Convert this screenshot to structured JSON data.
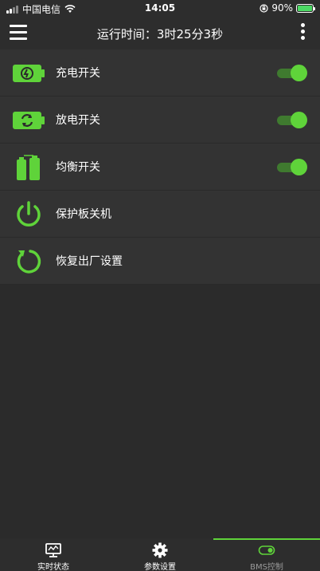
{
  "status_bar": {
    "carrier": "中国电信",
    "time": "14:05",
    "battery_percent": "90%",
    "battery_level": 0.9
  },
  "header": {
    "title": "运行时间：3时25分3秒",
    "menu_icon": "hamburger-menu-icon",
    "more_icon": "vertical-dots-icon"
  },
  "settings": {
    "items": [
      {
        "label": "充电开关",
        "icon": "charge-battery-icon",
        "toggle": true,
        "toggled_on": true
      },
      {
        "label": "放电开关",
        "icon": "discharge-battery-icon",
        "toggle": true,
        "toggled_on": true
      },
      {
        "label": "均衡开关",
        "icon": "balance-battery-icon",
        "toggle": true,
        "toggled_on": true
      },
      {
        "label": "保护板关机",
        "icon": "power-icon",
        "toggle": false
      },
      {
        "label": "恢复出厂设置",
        "icon": "reset-icon",
        "toggle": false
      }
    ]
  },
  "tabs": [
    {
      "label": "实时状态",
      "icon": "monitor-icon",
      "active": false
    },
    {
      "label": "参数设置",
      "icon": "gear-icon",
      "active": false
    },
    {
      "label": "BMS控制",
      "icon": "toggle-icon",
      "active": true
    }
  ],
  "colors": {
    "accent": "#5fd33a",
    "background": "#2b2b2b",
    "row": "#333333"
  }
}
